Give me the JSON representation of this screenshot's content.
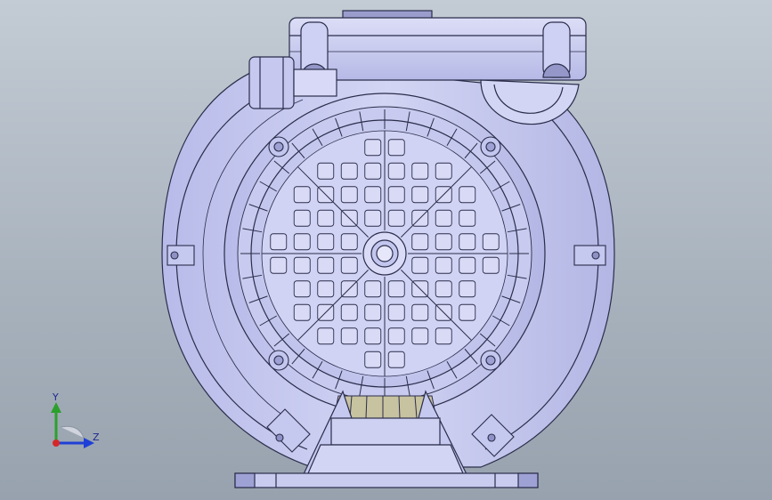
{
  "view": {
    "background_top": "#c3cbd4",
    "background_bottom": "#97a2ae",
    "model_fill": "#c9cbef",
    "model_shade": "#aeb1e0",
    "edge_color": "#2b2d4a",
    "bearing_color": "#c7c2a0"
  },
  "model": {
    "description_icon": "blower-motor-fan-cover",
    "grille": {
      "rows": 10,
      "cols": 10
    }
  },
  "triad": {
    "y_label": "Y",
    "z_label": "Z",
    "y_color": "#2ca02c",
    "z_color": "#1f3fd6",
    "x_color": "#d62728"
  }
}
